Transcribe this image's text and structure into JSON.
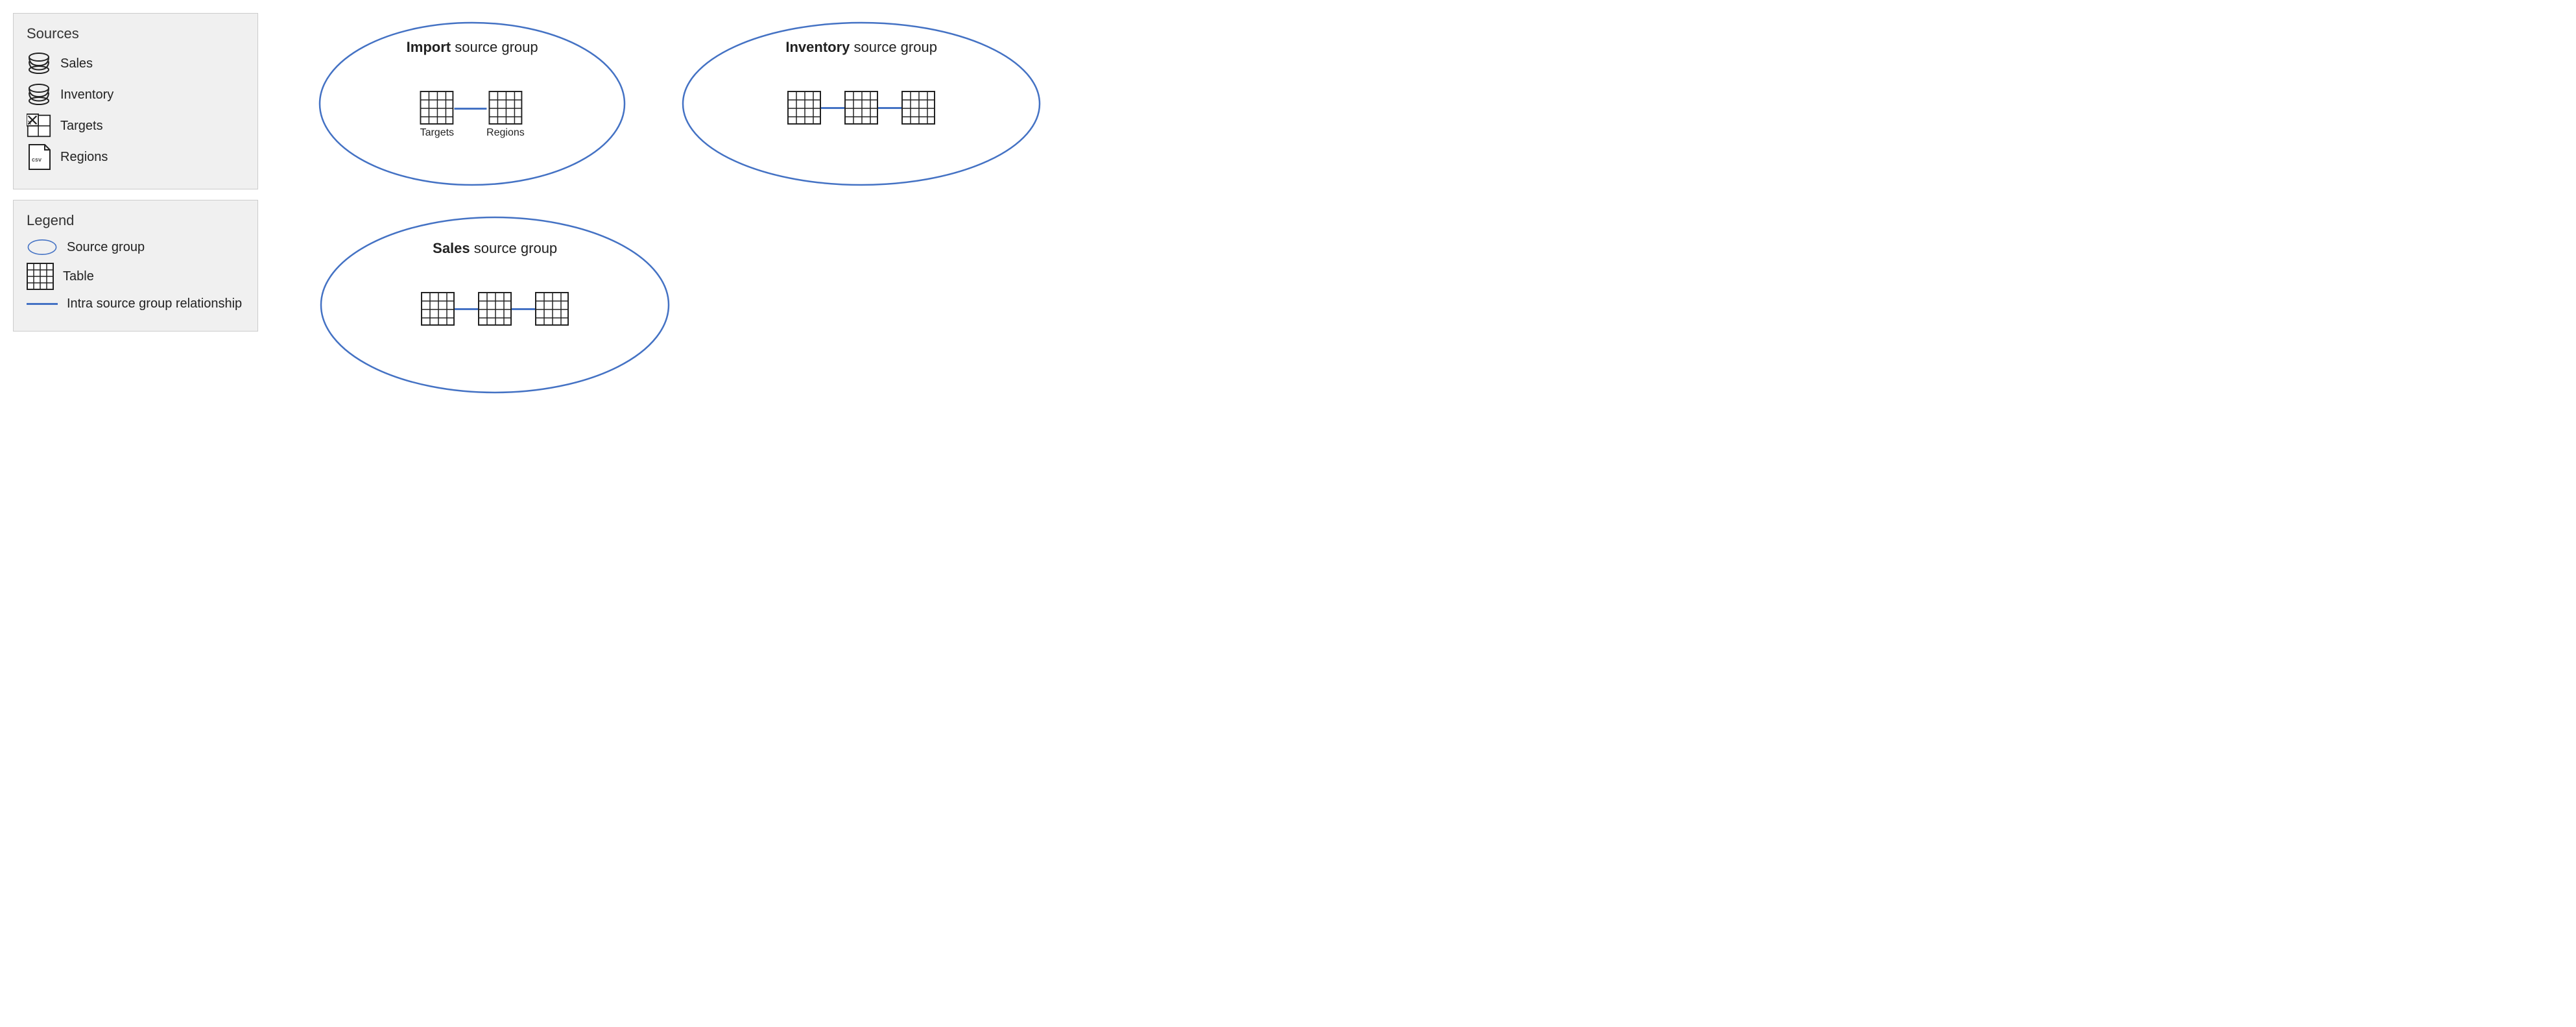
{
  "sources_panel": {
    "title": "Sources",
    "items": [
      {
        "id": "sales",
        "label": "Sales",
        "icon_type": "database"
      },
      {
        "id": "inventory",
        "label": "Inventory",
        "icon_type": "database"
      },
      {
        "id": "targets",
        "label": "Targets",
        "icon_type": "excel"
      },
      {
        "id": "regions",
        "label": "Regions",
        "icon_type": "csv"
      }
    ]
  },
  "legend_panel": {
    "title": "Legend",
    "items": [
      {
        "id": "source-group",
        "label": "Source group",
        "icon_type": "ellipse"
      },
      {
        "id": "table",
        "label": "Table",
        "icon_type": "table"
      },
      {
        "id": "relationship",
        "label": "Intra source group relationship",
        "icon_type": "line"
      }
    ]
  },
  "groups": [
    {
      "id": "import-group",
      "title_bold": "Import",
      "title_rest": " source group",
      "tables": [
        "Targets",
        "Regions"
      ],
      "connected": true,
      "table_count": 2
    },
    {
      "id": "inventory-group",
      "title_bold": "Inventory",
      "title_rest": " source group",
      "tables": [
        "",
        "",
        ""
      ],
      "connected": true,
      "table_count": 3
    },
    {
      "id": "sales-group",
      "title_bold": "Sales",
      "title_rest": " source group",
      "tables": [
        "",
        "",
        ""
      ],
      "connected": true,
      "table_count": 3
    }
  ],
  "colors": {
    "ellipse_stroke": "#4472C4",
    "line": "#4472C4",
    "background_panel": "#f0f0f0"
  }
}
